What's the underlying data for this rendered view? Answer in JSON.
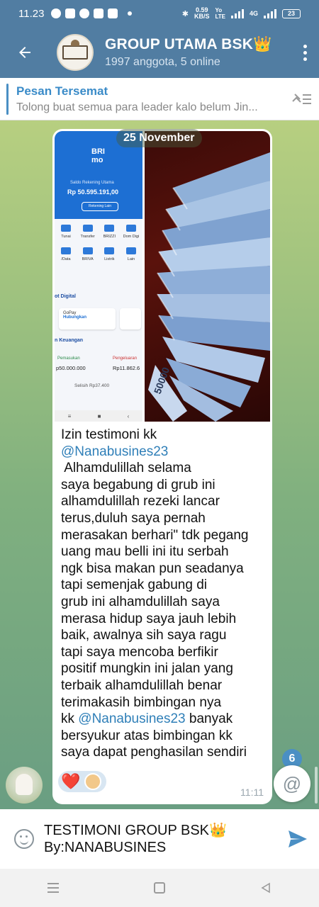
{
  "status_bar": {
    "time": "11.23",
    "net_speed_value": "0.59",
    "net_speed_unit": "KB/S",
    "net_type_top": "Yo",
    "net_type_bottom": "LTE",
    "network": "4G",
    "battery": "23"
  },
  "header": {
    "title": "GROUP UTAMA BSK",
    "title_emoji": "👑",
    "subtitle": "1997 anggota, 5 online"
  },
  "pinned": {
    "title": "Pesan Tersemat",
    "body": "Tolong buat semua para leader kalo belum Jin..."
  },
  "chat": {
    "date_label": "25 November",
    "photo_left": {
      "logo_line1": "BRI",
      "logo_line2": "mo",
      "saldo_label": "Saldo Rekening Utama",
      "saldo_value": "Rp 50.595.191,00",
      "button": "Rekening Lain",
      "row1": [
        "Tunai",
        "Transfer",
        "BRIZZI",
        "Dom Digi"
      ],
      "row2": [
        "/Data",
        "BRIVA",
        "Listrik",
        "Lain"
      ],
      "section1": "ot Digital",
      "gopay_label": "GoPay",
      "gopay_action": "Hubungkan",
      "section2": "n Keuangan",
      "income_label": "Pemasukan",
      "income_value": "p50.000.000",
      "expense_label": "Pengeluaran",
      "expense_value": "Rp11.862.6",
      "selisih": "Selisih  Rp37.400"
    },
    "message_lines": [
      {
        "text": "Izin testimoni kk"
      },
      {
        "text": "@Nanabusines23",
        "mention": true
      },
      {
        "text": " Alhamdulillah selama"
      },
      {
        "text": "saya begabung di grub ini"
      },
      {
        "text": "alhamdulillah rezeki lancar"
      },
      {
        "text": "terus,duluh saya pernah"
      },
      {
        "text": "merasakan berhari\" tdk pegang"
      },
      {
        "text": "uang mau belli ini itu serbah"
      },
      {
        "text": "ngk bisa makan pun seadanya"
      },
      {
        "text": "tapi semenjak gabung di"
      },
      {
        "text": "grub ini alhamdulillah saya"
      },
      {
        "text": "merasa hidup saya jauh lebih"
      },
      {
        "text": "baik, awalnya sih saya ragu"
      },
      {
        "text": "tapi saya mencoba berfikir"
      },
      {
        "text": "positif mungkin ini jalan yang"
      },
      {
        "text": "terbaik alhamdulillah benar"
      },
      {
        "text": "terimakasih bimbingan nya"
      },
      {
        "text": "kk ",
        "mention_after": "@Nanabusines23",
        "tail": " banyak"
      },
      {
        "text": "bersyukur atas bimbingan kk"
      },
      {
        "text": "saya dapat penghasilan sendiri"
      }
    ],
    "reaction_emoji": "❤️",
    "time": "11:11",
    "mention_count": "6",
    "mention_symbol": "@"
  },
  "input": {
    "line1": "TESTIMONI GROUP BSK",
    "line1_emoji": "👑",
    "line2": "By:NANABUSINES"
  },
  "colors": {
    "header_bg": "#517da2",
    "accent": "#4a8fc4",
    "mention": "#2f7fb8"
  }
}
